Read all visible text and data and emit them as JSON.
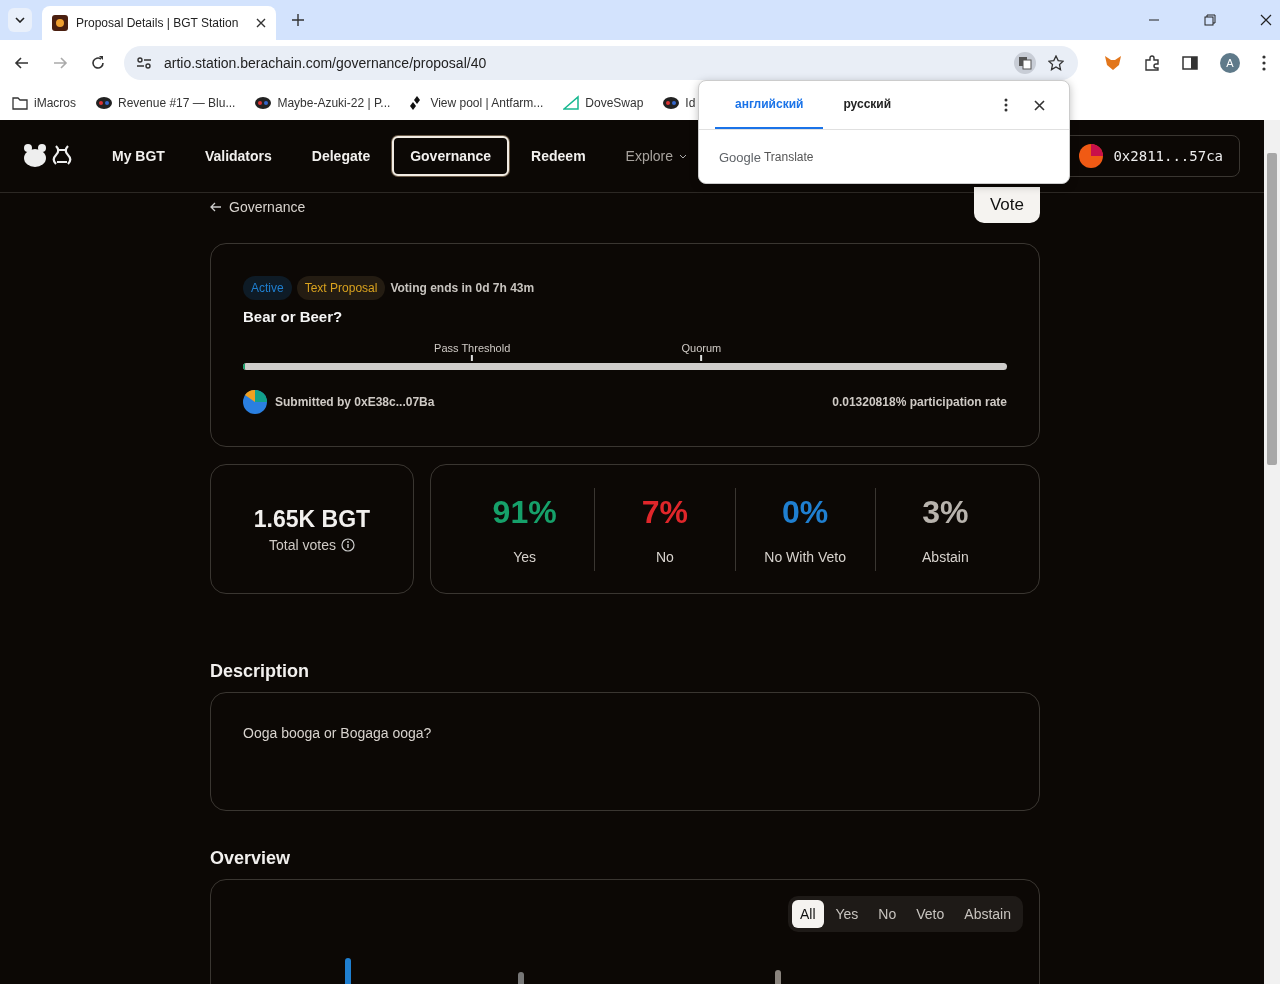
{
  "browser": {
    "tab_title": "Proposal Details | BGT Station",
    "url": "artio.station.berachain.com/governance/proposal/40",
    "profile_initial": "A",
    "bookmarks": [
      {
        "label": "iMacros",
        "kind": "folder"
      },
      {
        "label": "Revenue #17 — Blu...",
        "kind": "site"
      },
      {
        "label": "Maybe-Azuki-22 | P...",
        "kind": "site"
      },
      {
        "label": "View pool | Antfarm...",
        "kind": "pool"
      },
      {
        "label": "DoveSwap",
        "kind": "dove"
      },
      {
        "label": "Id",
        "kind": "site"
      }
    ]
  },
  "translate_popup": {
    "tabs": [
      {
        "label": "английский",
        "selected": true
      },
      {
        "label": "русский",
        "selected": false
      }
    ],
    "brand": "Google",
    "product": "Translate"
  },
  "nav": {
    "items": [
      {
        "label": "My BGT",
        "selected": false,
        "dropdown": false
      },
      {
        "label": "Validators",
        "selected": false,
        "dropdown": false
      },
      {
        "label": "Delegate",
        "selected": false,
        "dropdown": false
      },
      {
        "label": "Governance",
        "selected": true,
        "dropdown": false
      },
      {
        "label": "Redeem",
        "selected": false,
        "dropdown": false
      },
      {
        "label": "Explore",
        "selected": false,
        "dropdown": true
      }
    ],
    "wallet": "0x2811...57ca"
  },
  "back_link": "Governance",
  "vote_button": "Vote",
  "proposal": {
    "status": "Active",
    "type": "Text Proposal",
    "voting_ends": "Voting ends in 0d 7h 43m",
    "title": "Bear or Beer?",
    "markers": [
      {
        "label": "Pass Threshold"
      },
      {
        "label": "Quorum"
      }
    ],
    "level": 0.002,
    "submitted_by": "Submitted by 0xE38c...07Ba",
    "participation": "0.01320818% participation rate"
  },
  "total": {
    "value": "1.65K BGT",
    "label": "Total votes"
  },
  "results": [
    {
      "percent": "91%",
      "label": "Yes",
      "color": "#16a06a"
    },
    {
      "percent": "7%",
      "label": "No",
      "color": "#e0262a"
    },
    {
      "percent": "0%",
      "label": "No With Veto",
      "color": "#1f7fd0"
    },
    {
      "percent": "3%",
      "label": "Abstain",
      "color": "#b8b3ad"
    }
  ],
  "description": {
    "heading": "Description",
    "text": "Ooga booga or Bogaga ooga?"
  },
  "overview": {
    "heading": "Overview",
    "filters": [
      {
        "label": "All",
        "selected": true
      },
      {
        "label": "Yes",
        "selected": false
      },
      {
        "label": "No",
        "selected": false
      },
      {
        "label": "Veto",
        "selected": false
      },
      {
        "label": "Abstain",
        "selected": false
      }
    ]
  }
}
